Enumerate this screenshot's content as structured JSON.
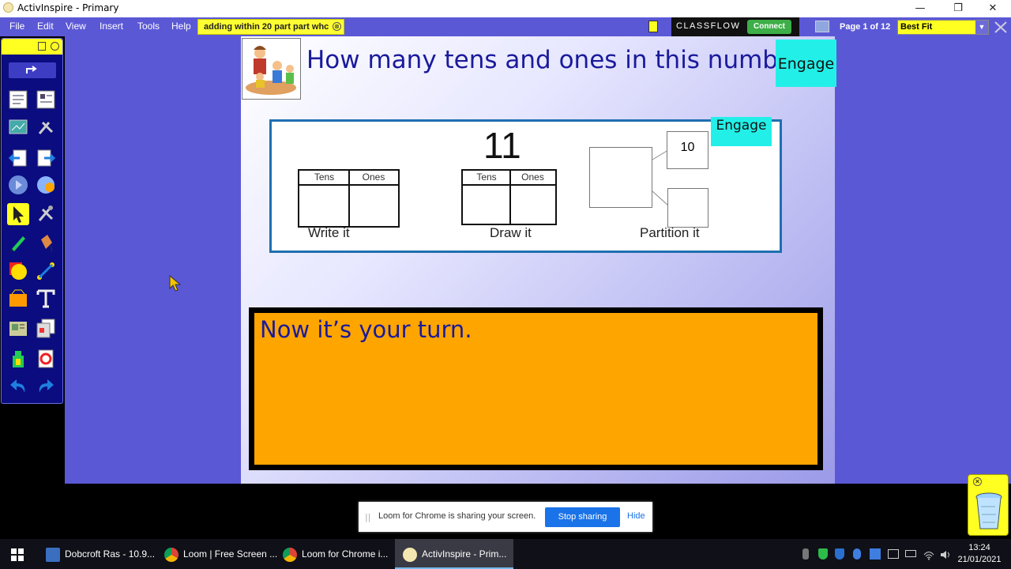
{
  "window": {
    "title": "ActivInspire - Primary",
    "min": "—",
    "max": "❐",
    "close": "✕"
  },
  "menu": [
    "File",
    "Edit",
    "View",
    "Insert",
    "Tools",
    "Help"
  ],
  "file_tab": {
    "label": "adding within 20 part part whc",
    "close": "⊗"
  },
  "classflow": {
    "brand": "CLASSFLOW",
    "connect": "Connect"
  },
  "page_info": "Page 1 of 12",
  "zoom": {
    "value": "Best Fit",
    "arrow": "▼"
  },
  "slide": {
    "heading": "How many tens and ones in this number?",
    "engage_top": "Engage",
    "engage_activity": "Engage",
    "number": "11",
    "table_headers": [
      "Tens",
      "Ones"
    ],
    "captions": {
      "write": "Write it",
      "draw": "Draw it",
      "partition": "Partition it"
    },
    "partition_value": "10",
    "turn_text": "Now it’s your turn."
  },
  "loom": {
    "grip": "||",
    "message": "Loom for Chrome is sharing your screen.",
    "stop": "Stop sharing",
    "hide": "Hide"
  },
  "taskbar": {
    "items": [
      "Dobcroft Ras - 10.9...",
      "Loom | Free Screen ...",
      "Loom for Chrome i...",
      "ActivInspire - Prim..."
    ],
    "time": "13:24",
    "date": "21/01/2021"
  },
  "colors": {
    "workspace": "#5b58d6",
    "heading": "#1a1a9c",
    "engage": "#22f0e8",
    "turn_box": "#ffa500",
    "highlight": "#ffff22"
  }
}
